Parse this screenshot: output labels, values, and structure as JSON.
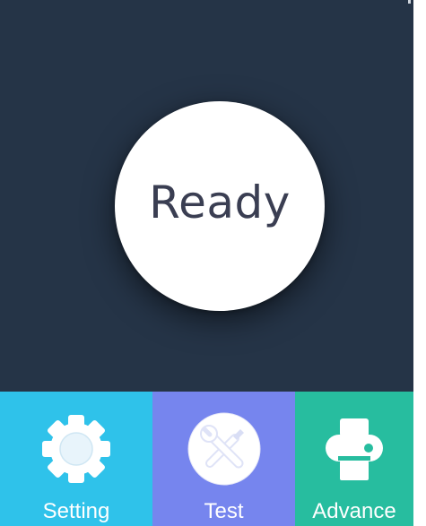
{
  "status": {
    "text": "Ready"
  },
  "nav": {
    "setting": {
      "label": "Setting",
      "icon": "gear-icon",
      "color": "#2fc2ea"
    },
    "test": {
      "label": "Test",
      "icon": "tools-icon",
      "color": "#7685ee"
    },
    "advance": {
      "label": "Advance",
      "icon": "printer-icon",
      "color": "#27bd9f"
    }
  },
  "colors": {
    "background": "#253447",
    "status_circle": "#ffffff",
    "status_text": "#3a3e52"
  }
}
